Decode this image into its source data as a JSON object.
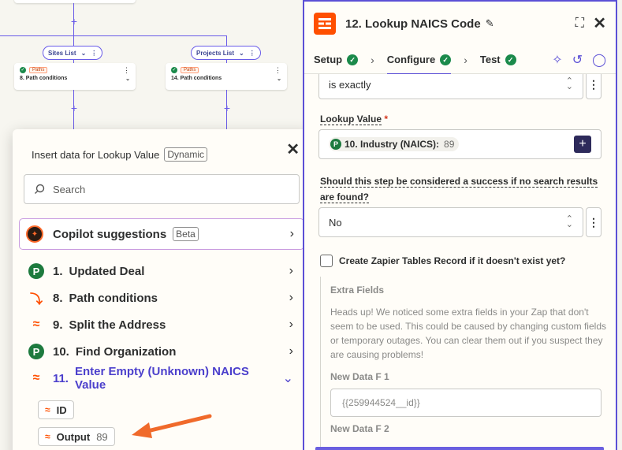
{
  "canvas": {
    "branches": [
      {
        "label": "Sites List",
        "card_chip": "Paths",
        "card_title": "8. Path conditions"
      },
      {
        "label": "Projects List",
        "card_chip": "Paths",
        "card_title": "14. Path conditions"
      }
    ]
  },
  "popup": {
    "title": "Insert data for Lookup Value",
    "badge": "Dynamic",
    "search_placeholder": "Search",
    "copilot": {
      "label": "Copilot suggestions",
      "badge": "Beta"
    },
    "steps": [
      {
        "icon": "pipedrive-icon",
        "num": "1.",
        "name": "Updated Deal"
      },
      {
        "icon": "path-icon",
        "num": "8.",
        "name": "Path conditions"
      },
      {
        "icon": "formatter-icon",
        "num": "9.",
        "name": "Split the Address"
      },
      {
        "icon": "pipedrive-icon",
        "num": "10.",
        "name": "Find Organization"
      },
      {
        "icon": "formatter-icon",
        "num": "11.",
        "name": "Enter Empty (Unknown) NAICS Value"
      }
    ],
    "fields": [
      {
        "label": "ID",
        "value": ""
      },
      {
        "label": "Output",
        "value": "89"
      }
    ]
  },
  "panel": {
    "title": "12. Lookup NAICS Code",
    "tabs": [
      "Setup",
      "Configure",
      "Test"
    ],
    "operator_value": "is exactly",
    "lookup_label": "Lookup Value",
    "required_mark": "*",
    "lookup_token": {
      "label": "10. Industry (NAICS):",
      "value": "89"
    },
    "question": "Should this step be considered a success if no search results are found?",
    "success_value": "No",
    "checkbox_label": "Create Zapier Tables Record if it doesn't exist yet?",
    "extra_fields": {
      "title": "Extra Fields",
      "text": "Heads up! We noticed some extra fields in your Zap that don't seem to be used. This could be caused by changing custom fields or temporary outages. You can clear them out if you suspect they are causing problems!",
      "field_label": "New Data F 1",
      "field_value": "{{259944524__id}}",
      "next_label": "New Data F 2"
    }
  },
  "colors": {
    "accent": "#5b4fd6",
    "brand": "#ff4f00",
    "success": "#1b8a4b",
    "arrow": "#f06a2b"
  }
}
